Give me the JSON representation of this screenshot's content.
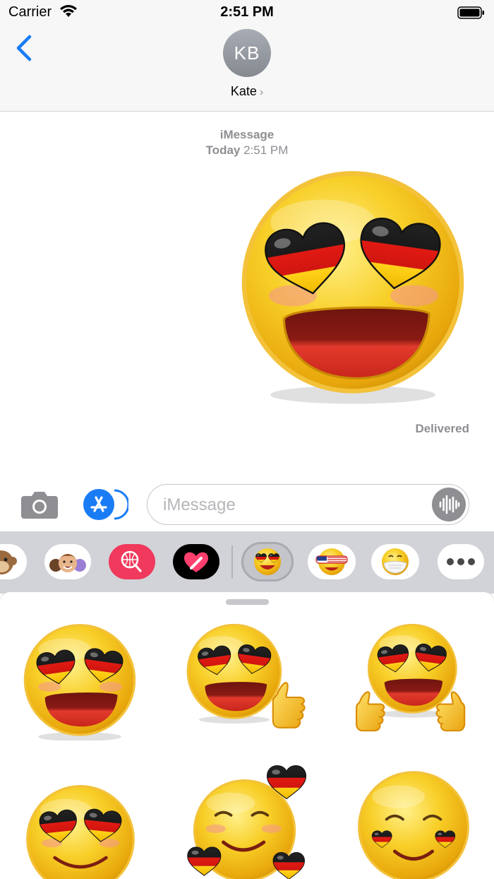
{
  "status": {
    "carrier": "Carrier",
    "time": "2:51 PM"
  },
  "nav": {
    "avatar_initials": "KB",
    "contact_name": "Kate",
    "chevron": "›"
  },
  "thread": {
    "service": "iMessage",
    "date_label": "Today",
    "time": "2:51 PM",
    "status": "Delivered"
  },
  "composer": {
    "placeholder": "iMessage"
  },
  "icons": [
    "back-chevron-icon",
    "camera-icon",
    "app-store-icon",
    "audio-waveform-icon",
    "more-icon"
  ],
  "tray": [
    "monkey-memoji",
    "memoji-stickers",
    "web-search-images",
    "digital-touch",
    "germany-emoji-stickers",
    "usa-glasses-emoji",
    "mask-emoji",
    "more"
  ],
  "colors": {
    "accent": "#1a7cf5",
    "flag_black": "#1a1a1a",
    "flag_red": "#dd1a12",
    "flag_gold": "#ffce00",
    "emoji_yellow": "#f6c417"
  }
}
